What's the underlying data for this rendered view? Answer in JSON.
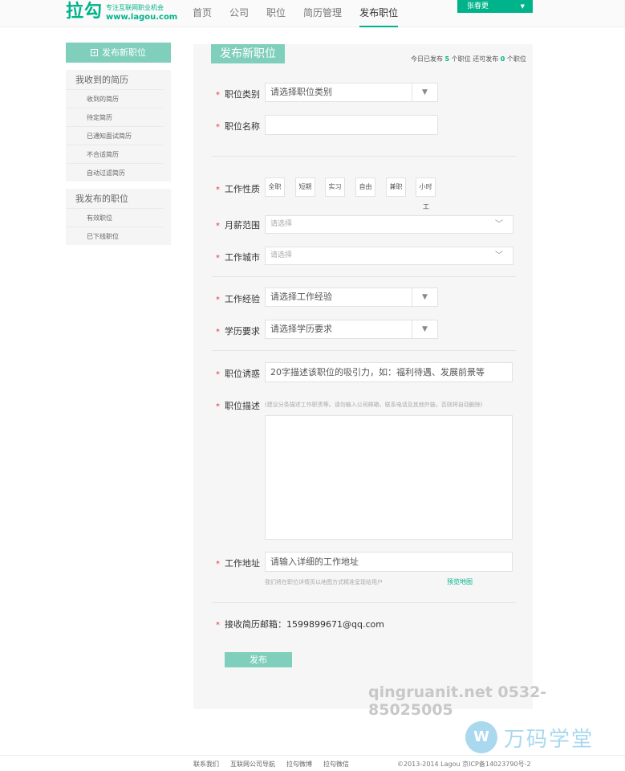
{
  "header": {
    "logo_mark": "拉勾",
    "logo_slogan": "专注互联网职业机会",
    "logo_url": "www.lagou.com",
    "nav": [
      "首页",
      "公司",
      "职位",
      "简历管理",
      "发布职位"
    ],
    "active_nav": "发布职位",
    "user_name": "张春更",
    "accent_color": "#00b38a"
  },
  "sidebar": {
    "publish_button": "发布新职位",
    "received_title": "我收到的简历",
    "received_items": [
      "收到的简历",
      "待定简历",
      "已通知面试简历",
      "不合适简历",
      "自动过滤简历"
    ],
    "posted_title": "我发布的职位",
    "posted_items": [
      "有效职位",
      "已下线职位"
    ]
  },
  "form": {
    "title": "发布新职位",
    "stat_prefix": "今日已发布",
    "stat_published": "5",
    "stat_middle": "个职位 还可发布",
    "stat_remaining": "0",
    "stat_suffix": "个职位",
    "category_label": "职位类别",
    "category_value": "请选择职位类别",
    "name_label": "职位名称",
    "name_value": "",
    "nature_label": "工作性质",
    "nature_options": [
      "全职",
      "短期",
      "实习",
      "自由",
      "兼职",
      "小时"
    ],
    "nature_extra": "工",
    "salary_label": "月薪范围",
    "salary_placeholder": "请选择",
    "city_label": "工作城市",
    "city_placeholder": "请选择",
    "experience_label": "工作经验",
    "experience_value": "请选择工作经验",
    "education_label": "学历要求",
    "education_value": "请选择学历要求",
    "lure_label": "职位诱惑",
    "lure_placeholder": "20字描述该职位的吸引力，如：福利待遇、发展前景等",
    "desc_label": "职位描述",
    "desc_hint": "(建议分条描述工作职责等。请勿输入公司邮箱、联系电话及其他外链，否则将自动删除)",
    "address_label": "工作地址",
    "address_placeholder": "请输入详细的工作地址",
    "address_hint": "我们将在职位详情页以地图方式精准呈现给用户",
    "map_link": "预览地图",
    "email_label": "接收简历邮箱：",
    "email_value": "1599899671@qq.com",
    "submit": "发布"
  },
  "watermark": {
    "text": "qingruanit.net 0532-85025005",
    "logo_glyph": "W",
    "logo_name": "万码学堂"
  },
  "footer": {
    "links": [
      "联系我们",
      "互联网公司导航",
      "拉勾微博",
      "拉勾微信"
    ],
    "copyright": "©2013-2014 Lagou   京ICP备14023790号-2"
  }
}
